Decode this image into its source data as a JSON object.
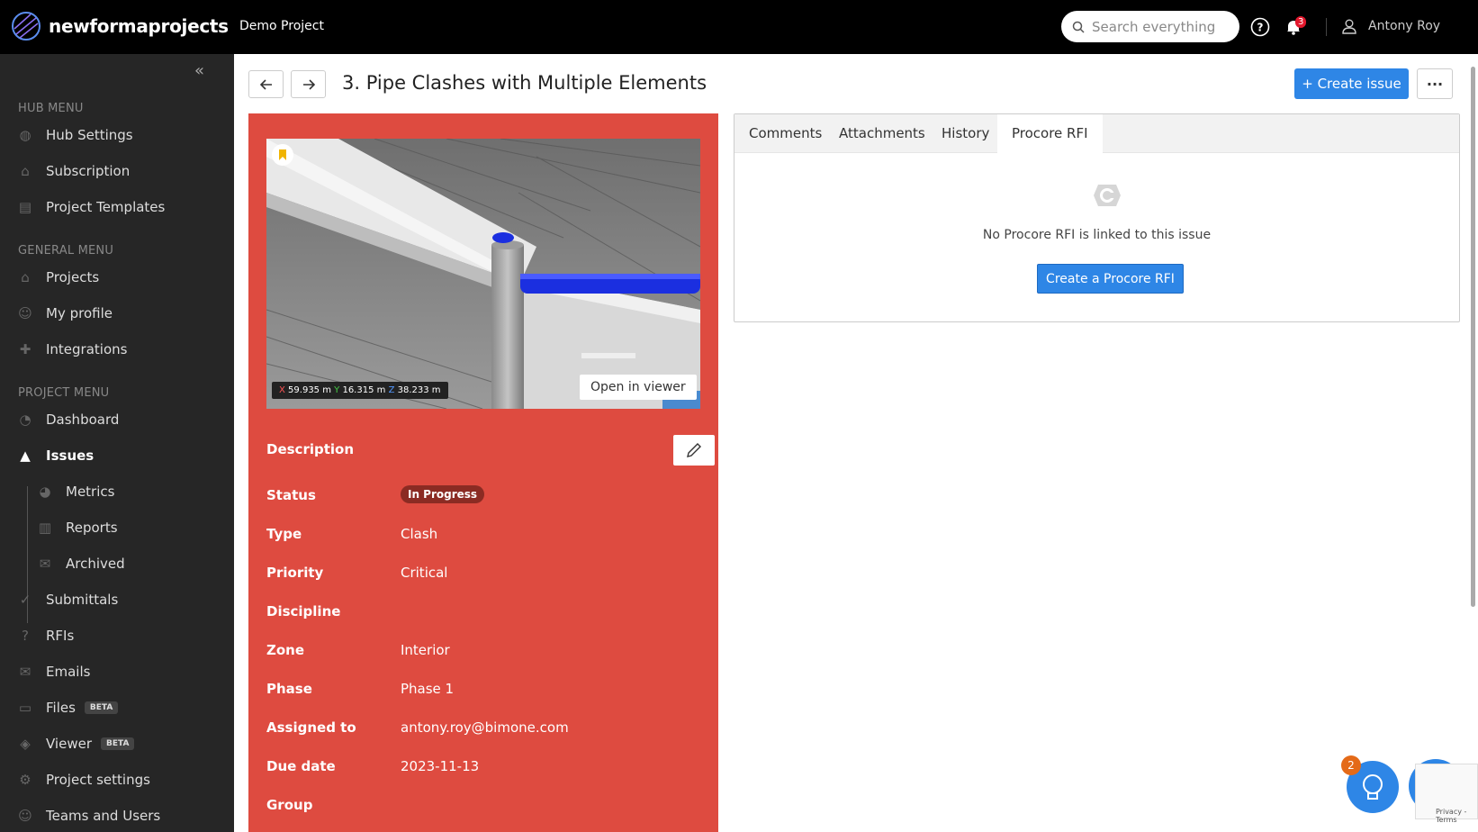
{
  "app": {
    "brand": "newformaprojects",
    "project": "Demo Project"
  },
  "header": {
    "search_placeholder": "Search everything",
    "notifications": "3",
    "user": "Antony Roy"
  },
  "sidebar": {
    "hub_menu": "HUB MENU",
    "hub_items": [
      "Hub Settings",
      "Subscription",
      "Project Templates"
    ],
    "general_menu": "GENERAL MENU",
    "general_items": [
      "Projects",
      "My profile",
      "Integrations"
    ],
    "project_menu": "PROJECT MENU",
    "project_items": [
      "Dashboard",
      "Issues",
      "Metrics",
      "Reports",
      "Archived",
      "Submittals",
      "RFIs",
      "Emails",
      "Files",
      "Viewer",
      "Project settings",
      "Teams and Users"
    ],
    "beta": "BETA"
  },
  "issue": {
    "title": "3. Pipe Clashes with Multiple Elements",
    "create_issue": "+ Create issue",
    "open_in_viewer": "Open in viewer",
    "coords": {
      "x_label": "X",
      "x": "59.935 m",
      "y_label": "Y",
      "y": "16.315 m",
      "z_label": "Z",
      "z": "38.233 m"
    },
    "fields": {
      "description": "Description",
      "status": "Status",
      "status_value": "In Progress",
      "type": "Type",
      "type_value": "Clash",
      "priority": "Priority",
      "priority_value": "Critical",
      "discipline": "Discipline",
      "zone": "Zone",
      "zone_value": "Interior",
      "phase": "Phase",
      "phase_value": "Phase 1",
      "assigned_to": "Assigned to",
      "assigned_to_value": "antony.roy@bimone.com",
      "due_date": "Due date",
      "due_date_value": "2023-11-13",
      "group": "Group"
    }
  },
  "panel": {
    "tabs": [
      "Comments",
      "Attachments",
      "History",
      "Procore RFI"
    ],
    "active_tab": "Procore RFI",
    "empty_message": "No Procore RFI is linked to this issue",
    "create_button": "Create a Procore RFI"
  },
  "widgets": {
    "help_count": "2",
    "captcha_text": "Privacy - Terms"
  },
  "colors": {
    "accent": "#2e86e6",
    "issue_card": "#de4b40",
    "sidebar": "#262626"
  }
}
